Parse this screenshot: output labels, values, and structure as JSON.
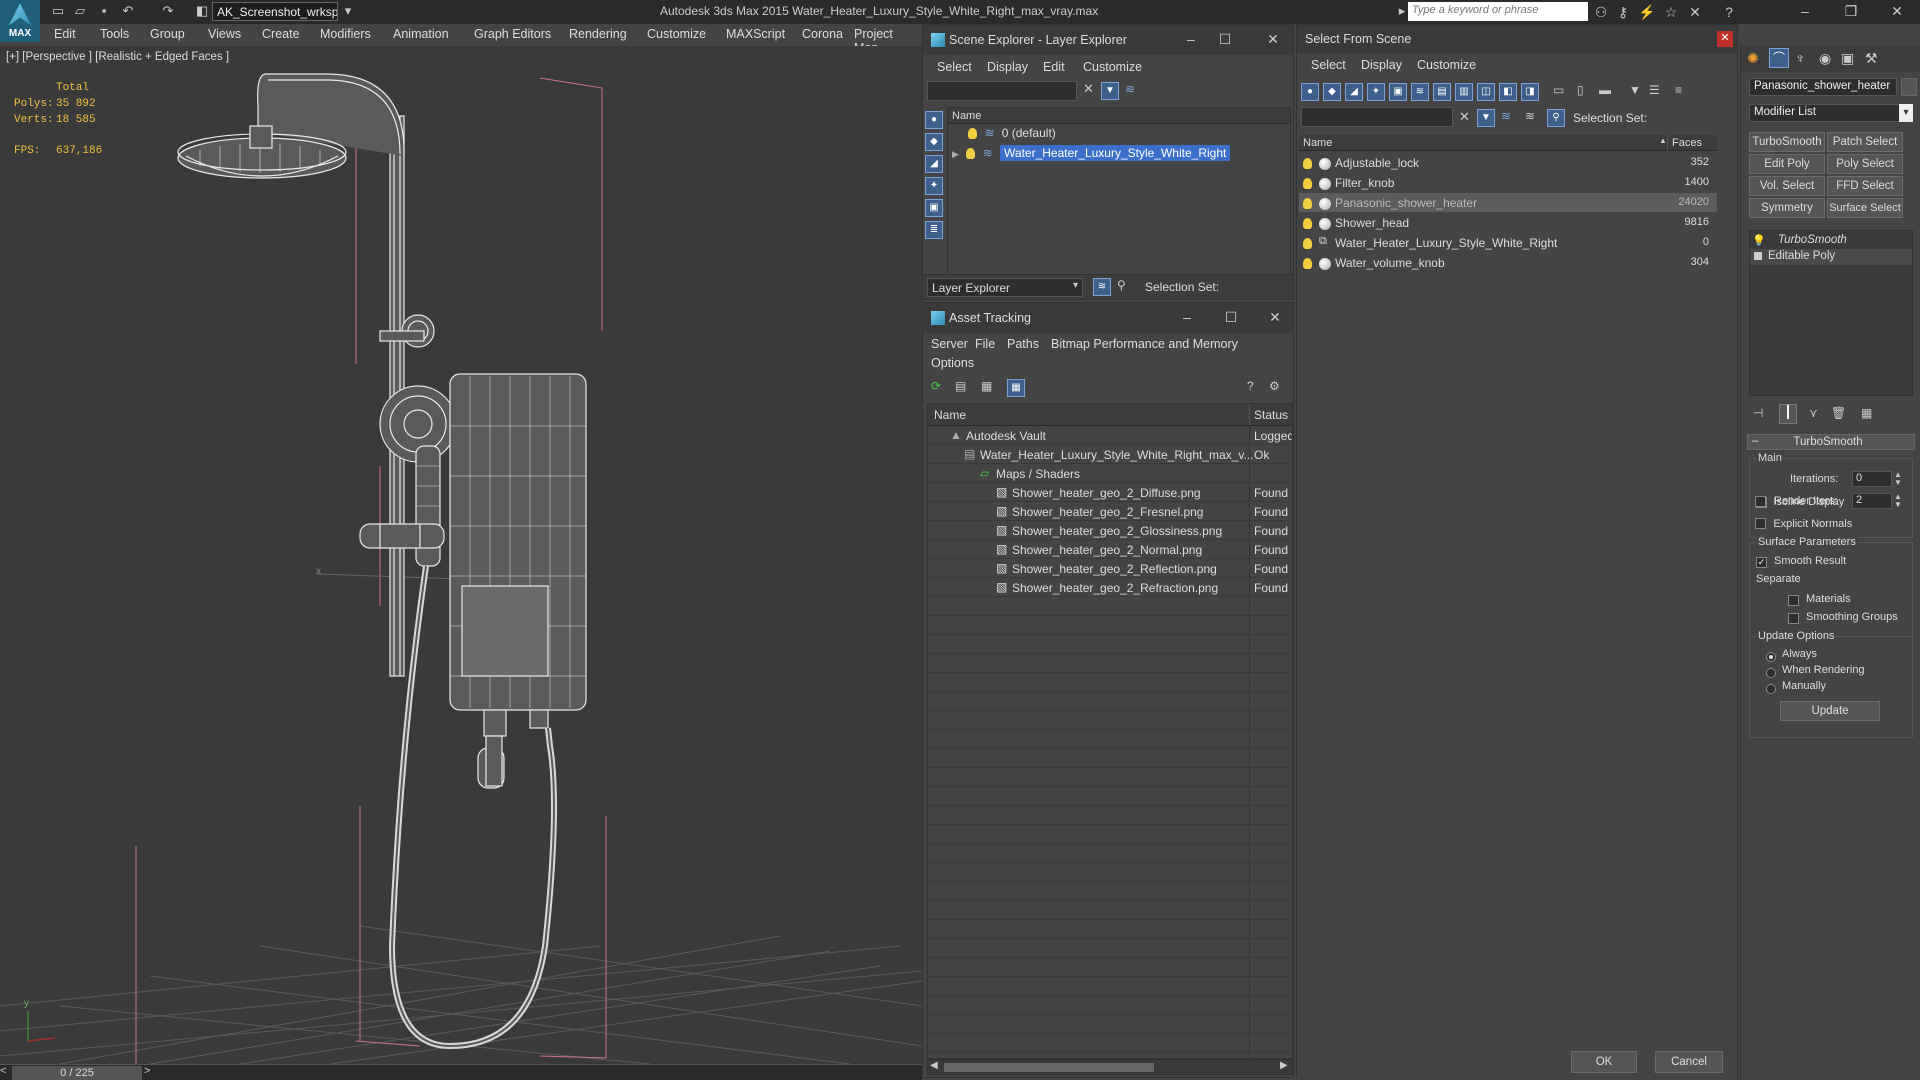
{
  "app": {
    "title": "Autodesk 3ds Max  2015    Water_Heater_Luxury_Style_White_Right_max_vray.max",
    "logo_label": "MAX",
    "workspace": "AK_Screenshot_wrksp",
    "search_placeholder": "Type a keyword or phrase"
  },
  "menubar": [
    "Edit",
    "Tools",
    "Group",
    "Views",
    "Create",
    "Modifiers",
    "Animation",
    "Graph Editors",
    "Rendering",
    "Customize",
    "MAXScript",
    "Corona",
    "Project Man"
  ],
  "viewport": {
    "label": "[+] [Perspective ] [Realistic + Edged Faces ]",
    "stats": {
      "total_label": "Total",
      "polys_label": "Polys:",
      "polys": "35 892",
      "verts_label": "Verts:",
      "verts": "18 585",
      "fps_label": "FPS:",
      "fps": "637,186"
    },
    "axis_x": "x",
    "axis_y": "y"
  },
  "timeline": {
    "frame": "0 / 225",
    "prev": "<",
    "next": ">"
  },
  "scene_explorer": {
    "title": "Scene Explorer - Layer Explorer",
    "menus": [
      "Select",
      "Display",
      "Edit",
      "Customize"
    ],
    "column_name": "Name",
    "layers": [
      {
        "name": "0 (default)",
        "selected": false
      },
      {
        "name": "Water_Heater_Luxury_Style_White_Right",
        "selected": true
      }
    ],
    "footer_dropdown": "Layer Explorer",
    "selection_set_label": "Selection Set:"
  },
  "asset_tracking": {
    "title": "Asset Tracking",
    "menus": [
      "Server",
      "File",
      "Paths",
      "Bitmap Performance and Memory"
    ],
    "menus2": [
      "Options"
    ],
    "col_name": "Name",
    "col_status": "Status",
    "rows": [
      {
        "name": "Autodesk Vault",
        "status": "Logged",
        "indent": 1
      },
      {
        "name": "Water_Heater_Luxury_Style_White_Right_max_v...",
        "status": "Ok",
        "indent": 2
      },
      {
        "name": "Maps / Shaders",
        "status": "",
        "indent": 3
      },
      {
        "name": "Shower_heater_geo_2_Diffuse.png",
        "status": "Found",
        "indent": 4
      },
      {
        "name": "Shower_heater_geo_2_Fresnel.png",
        "status": "Found",
        "indent": 4
      },
      {
        "name": "Shower_heater_geo_2_Glossiness.png",
        "status": "Found",
        "indent": 4
      },
      {
        "name": "Shower_heater_geo_2_Normal.png",
        "status": "Found",
        "indent": 4
      },
      {
        "name": "Shower_heater_geo_2_Reflection.png",
        "status": "Found",
        "indent": 4
      },
      {
        "name": "Shower_heater_geo_2_Refraction.png",
        "status": "Found",
        "indent": 4
      }
    ]
  },
  "select_from_scene": {
    "title": "Select From Scene",
    "menus": [
      "Select",
      "Display",
      "Customize"
    ],
    "selection_set_label": "Selection Set:",
    "col_name": "Name",
    "col_faces": "Faces",
    "objects": [
      {
        "name": "Adjustable_lock",
        "faces": "352",
        "selected": false
      },
      {
        "name": "Filter_knob",
        "faces": "1400",
        "selected": false
      },
      {
        "name": "Panasonic_shower_heater",
        "faces": "24020",
        "selected": true
      },
      {
        "name": "Shower_head",
        "faces": "9816",
        "selected": false
      },
      {
        "name": "Water_Heater_Luxury_Style_White_Right",
        "faces": "0",
        "selected": false
      },
      {
        "name": "Water_volume_knob",
        "faces": "304",
        "selected": false
      }
    ],
    "ok": "OK",
    "cancel": "Cancel"
  },
  "command_panel": {
    "object_name": "Panasonic_shower_heater",
    "modifier_list": "Modifier List",
    "buttons": [
      "TurboSmooth",
      "Patch Select",
      "Edit Poly",
      "Poly Select",
      "Vol. Select",
      "FFD Select",
      "Symmetry",
      "Surface Select"
    ],
    "stack": [
      "TurboSmooth",
      "Editable Poly"
    ],
    "rollout_title": "TurboSmooth",
    "main_label": "Main",
    "iterations_label": "Iterations:",
    "iterations": "0",
    "render_iters_label": "Render Iters:",
    "render_iters": "2",
    "isoline": "Isoline Display",
    "explicit_normals": "Explicit Normals",
    "surface_params": "Surface Parameters",
    "smooth_result": "Smooth Result",
    "separate": "Separate",
    "materials": "Materials",
    "smoothing_groups": "Smoothing Groups",
    "update_options": "Update Options",
    "always": "Always",
    "when_rendering": "When Rendering",
    "manually": "Manually",
    "update": "Update"
  },
  "colors": {
    "accent": "#3b6fc9",
    "stat_yellow": "#f0c040",
    "pink_guides": "#d07090"
  }
}
